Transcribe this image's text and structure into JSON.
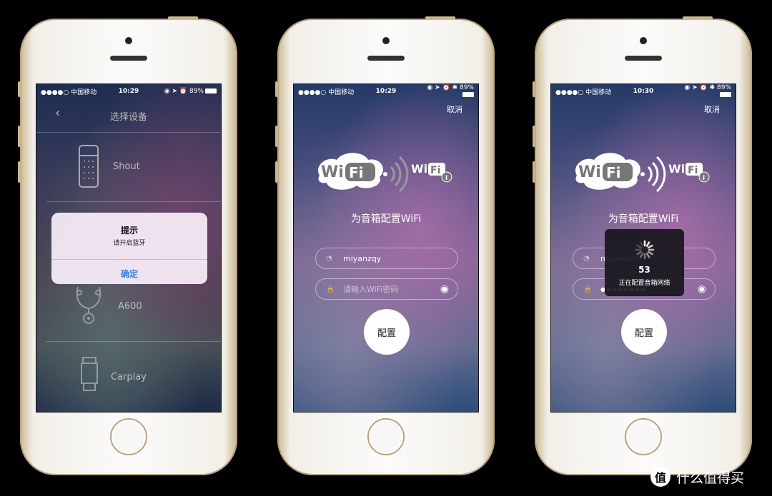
{
  "status_bar": {
    "carrier": "●●●●○ 中国移动",
    "battery": "89%",
    "icons": [
      "wifi-icon",
      "lock-rotation-icon",
      "location-icon",
      "alarm-icon",
      "bluetooth-icon",
      "battery-icon"
    ]
  },
  "phone1": {
    "time": "10:29",
    "title": "选择设备",
    "devices": [
      {
        "name": "Shout",
        "icon": "speaker-icon"
      },
      {
        "name": "A600",
        "icon": "earphones-icon"
      },
      {
        "name": "Carplay",
        "icon": "car-charger-icon"
      }
    ],
    "alert": {
      "title": "提示",
      "message": "请开启蓝牙",
      "confirm": "确定"
    }
  },
  "phone2": {
    "time": "10:29",
    "cancel": "取消",
    "title": "为音箱配置WiFi",
    "ssid": "miyanzqy",
    "password_placeholder": "请输入WiFi密码",
    "configure": "配置"
  },
  "phone3": {
    "time": "10:30",
    "cancel": "取消",
    "title": "为音箱配置WiFi",
    "ssid": "miyanzqy",
    "password_dots": "●●●●●●●●",
    "configure": "配置",
    "loading": {
      "countdown": "53",
      "message": "正在配置音箱网络"
    }
  },
  "watermark": {
    "badge": "值",
    "text": "什么值得买"
  },
  "colors": {
    "accent_blue": "#2a7ff0",
    "phone_gold": "#cbb68d"
  }
}
